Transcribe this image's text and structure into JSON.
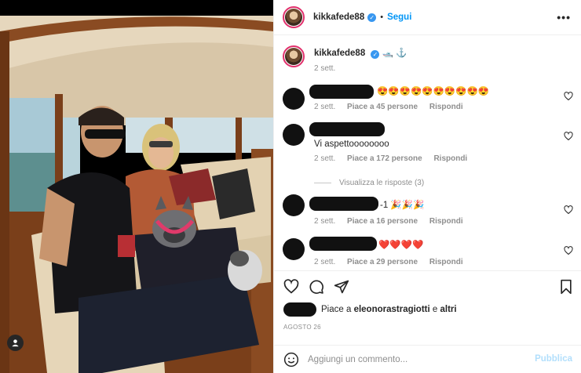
{
  "post": {
    "username": "kikkafede88",
    "follow_label": "Segui",
    "separator": "•",
    "more_icon": "more-horizontal-icon"
  },
  "caption": {
    "username": "kikkafede88",
    "emoji": "🛥️ ⚓",
    "time": "2 sett."
  },
  "comments": [
    {
      "text": "😍😍😍😍😍😍😍😍😍😍",
      "time": "2 sett.",
      "likes": "Piace a 45 persone",
      "reply": "Rispondi"
    },
    {
      "text": "Vi aspettoooooooo",
      "time": "2 sett.",
      "likes": "Piace a 172 persone",
      "reply": "Rispondi"
    },
    {
      "text": "-1 🎉🎉🎉",
      "time": "2 sett.",
      "likes": "Piace a 16 persone",
      "reply": "Rispondi"
    },
    {
      "text": "❤️❤️❤️❤️",
      "time": "2 sett.",
      "likes": "Piace a 29 persone",
      "reply": "Rispondi"
    }
  ],
  "replies_label": "Visualizza le risposte (3)",
  "likes": {
    "prefix": "Piace a",
    "user": "eleonorastragiotti",
    "conj": "e",
    "others": "altri"
  },
  "date": "AGOSTO 26",
  "add_comment": {
    "placeholder": "Aggiungi un commento...",
    "publish": "Pubblica"
  },
  "colors": {
    "accent": "#0095f6",
    "publish_disabled": "#b2dffc",
    "muted": "#8e8e8e"
  }
}
